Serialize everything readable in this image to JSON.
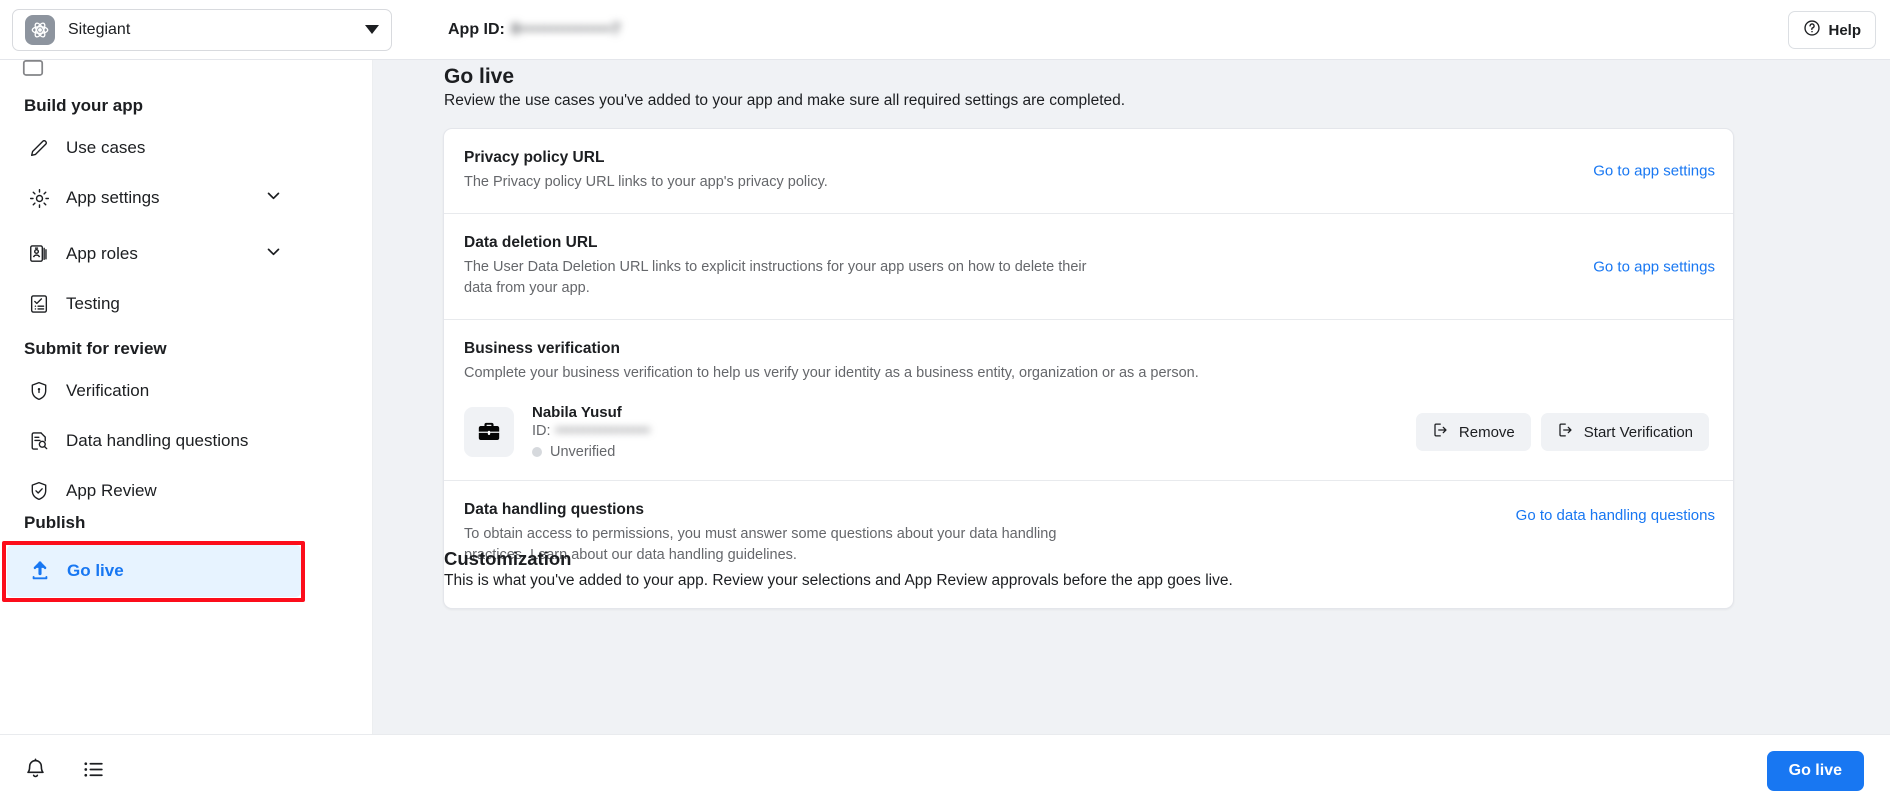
{
  "topbar": {
    "app_name": "Sitegiant",
    "app_icon": "atom-icon",
    "app_id_label": "App ID:",
    "app_id_value": "8•••••••••••••••7",
    "help_label": "Help",
    "help_icon": "question-circle-icon"
  },
  "sidebar": {
    "sections": [
      {
        "heading": "Build your app",
        "items": [
          {
            "label": "Use cases",
            "icon": "pencil-icon",
            "chevron": false,
            "active": false
          },
          {
            "label": "App settings",
            "icon": "gear-icon",
            "chevron": true,
            "active": false
          },
          {
            "label": "App roles",
            "icon": "id-card-icon",
            "chevron": true,
            "active": false
          },
          {
            "label": "Testing",
            "icon": "checklist-icon",
            "chevron": false,
            "active": false
          }
        ]
      },
      {
        "heading": "Submit for review",
        "items": [
          {
            "label": "Verification",
            "icon": "shield-lock-icon",
            "chevron": false,
            "active": false
          },
          {
            "label": "Data handling questions",
            "icon": "document-search-icon",
            "chevron": false,
            "active": false
          },
          {
            "label": "App Review",
            "icon": "shield-check-icon",
            "chevron": false,
            "active": false
          }
        ]
      },
      {
        "heading": "Publish",
        "items": [
          {
            "label": "Go live",
            "icon": "upload-icon",
            "chevron": false,
            "active": true
          }
        ]
      }
    ],
    "footer": {
      "notifications_icon": "bell-icon",
      "list_icon": "list-icon"
    }
  },
  "main": {
    "title": "Go live",
    "subtitle": "Review the use cases you've added to your app and make sure all required settings are completed.",
    "rows": [
      {
        "title": "Privacy policy URL",
        "desc": "The Privacy policy URL links to your app's privacy policy.",
        "link": "Go to app settings"
      },
      {
        "title": "Data deletion URL",
        "desc": "The User Data Deletion URL links to explicit instructions for your app users on how to delete their data from your app.",
        "link": "Go to app settings"
      },
      {
        "title": "Business verification",
        "desc": "Complete your business verification to help us verify your identity as a business entity, organization or as a person.",
        "business": {
          "avatar_icon": "briefcase-icon",
          "name": "Nabila Yusuf",
          "id_label": "ID:",
          "id_value": "•••••••••••••••••",
          "status": "Unverified",
          "buttons": [
            {
              "label": "Remove",
              "icon": "exit-arrow-icon"
            },
            {
              "label": "Start Verification",
              "icon": "exit-arrow-icon"
            }
          ]
        }
      },
      {
        "title": "Data handling questions",
        "desc": "To obtain access to permissions, you must answer some questions about your data handling practices. Learn about our data handling guidelines.",
        "link": "Go to data handling questions"
      }
    ],
    "customization": {
      "title": "Customization",
      "desc": "This is what you've added to your app. Review your selections and App Review approvals before the app goes live."
    }
  },
  "bottombar": {
    "go_live_label": "Go live"
  },
  "colors": {
    "accent": "#1877f2",
    "active_bg": "#e7f3ff",
    "highlight": "#fc0d1b",
    "page_bg": "#f0f2f5"
  }
}
